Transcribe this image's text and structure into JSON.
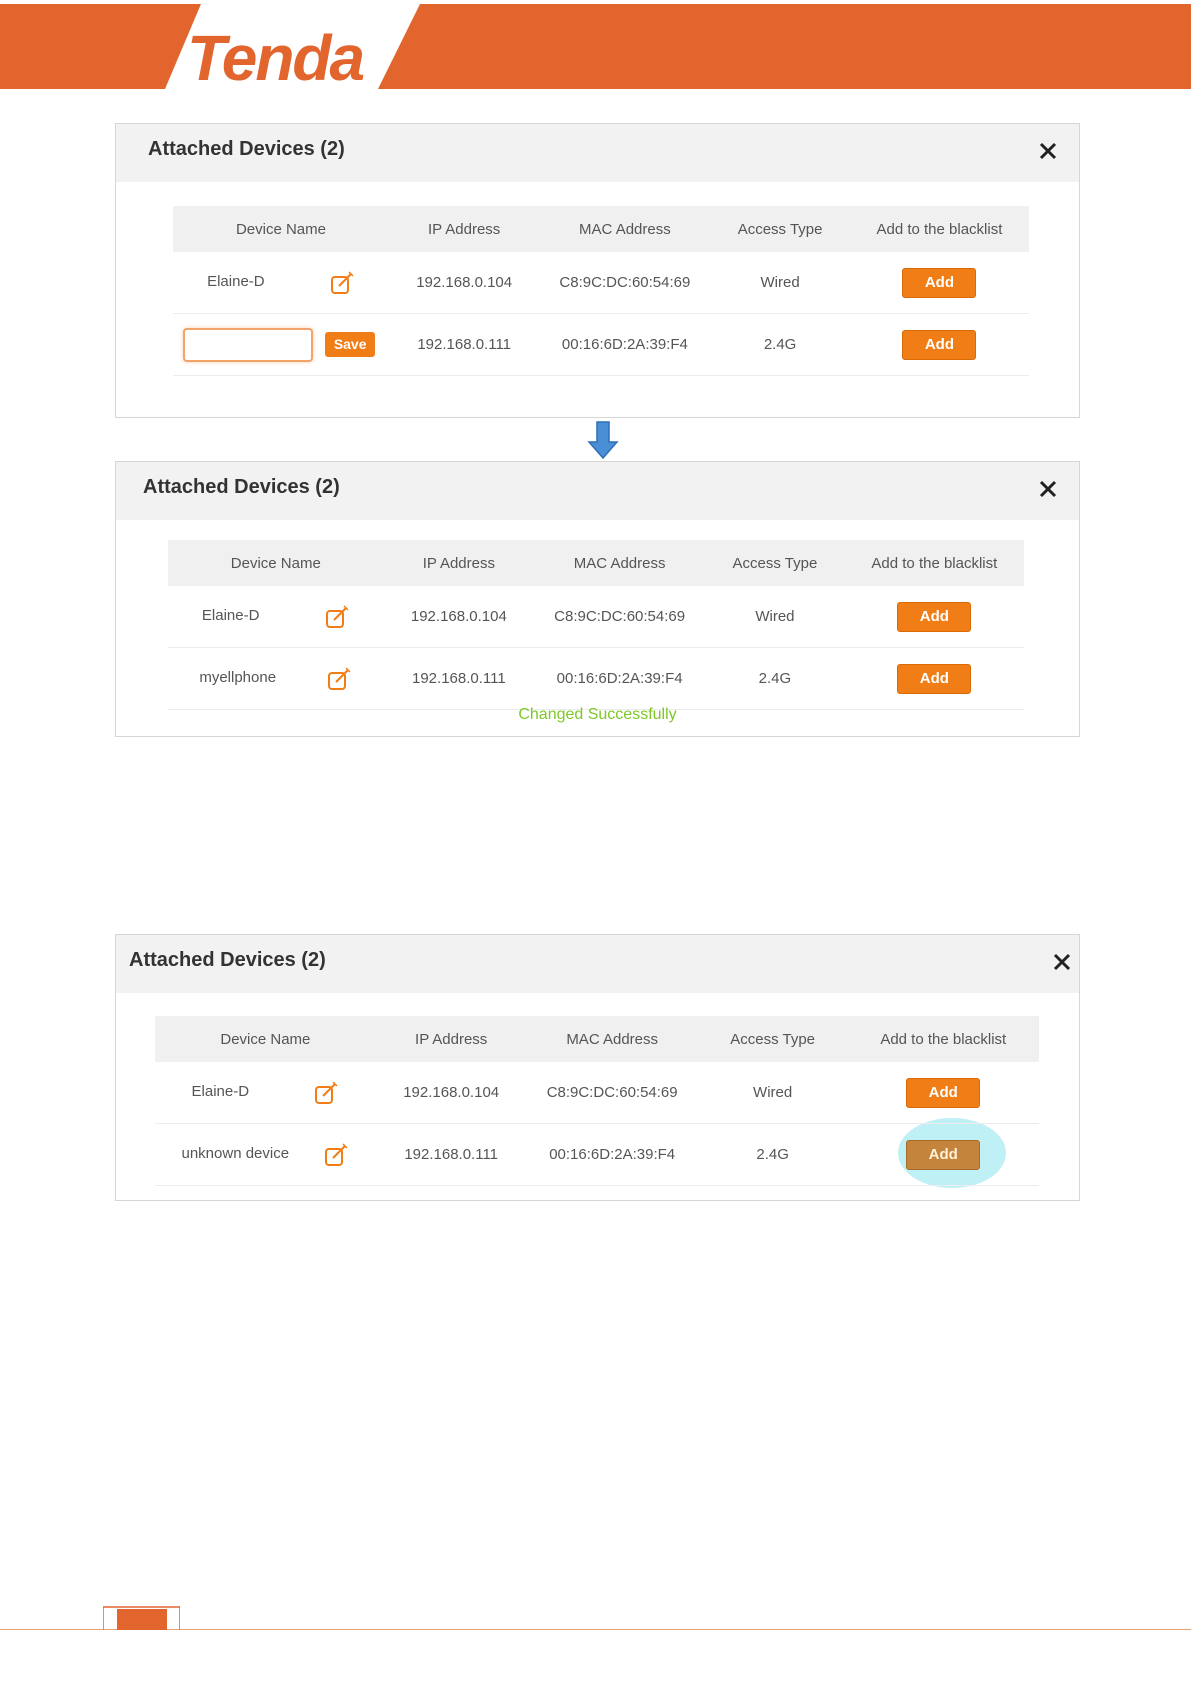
{
  "brand": {
    "logo_text": "Tenda",
    "color": "#e3652e"
  },
  "colors": {
    "accent": "#f07d15",
    "success": "#7ec828",
    "highlight": "#bff0f6"
  },
  "panels": [
    {
      "title": "Attached Devices (2)",
      "columns": [
        "Device Name",
        "IP Address",
        "MAC Address",
        "Access Type",
        "Add to the blacklist"
      ],
      "rows": [
        {
          "name": "Elaine-D",
          "ip": "192.168.0.104",
          "mac": "C8:9C:DC:60:54:69",
          "type": "Wired",
          "action": "Add"
        },
        {
          "name_input_value": "",
          "save_label": "Save",
          "ip": "192.168.0.111",
          "mac": "00:16:6D:2A:39:F4",
          "type": "2.4G",
          "action": "Add"
        }
      ]
    },
    {
      "title": "Attached Devices (2)",
      "columns": [
        "Device Name",
        "IP Address",
        "MAC Address",
        "Access Type",
        "Add to the blacklist"
      ],
      "rows": [
        {
          "name": "Elaine-D",
          "ip": "192.168.0.104",
          "mac": "C8:9C:DC:60:54:69",
          "type": "Wired",
          "action": "Add"
        },
        {
          "name": "myellphone",
          "ip": "192.168.0.111",
          "mac": "00:16:6D:2A:39:F4",
          "type": "2.4G",
          "action": "Add"
        }
      ],
      "status": "Changed Successfully"
    },
    {
      "title": "Attached Devices (2)",
      "columns": [
        "Device Name",
        "IP Address",
        "MAC Address",
        "Access Type",
        "Add to the blacklist"
      ],
      "rows": [
        {
          "name": "Elaine-D",
          "ip": "192.168.0.104",
          "mac": "C8:9C:DC:60:54:69",
          "type": "Wired",
          "action": "Add"
        },
        {
          "name": "unknown device",
          "ip": "192.168.0.111",
          "mac": "00:16:6D:2A:39:F4",
          "type": "2.4G",
          "action": "Add"
        }
      ]
    }
  ]
}
